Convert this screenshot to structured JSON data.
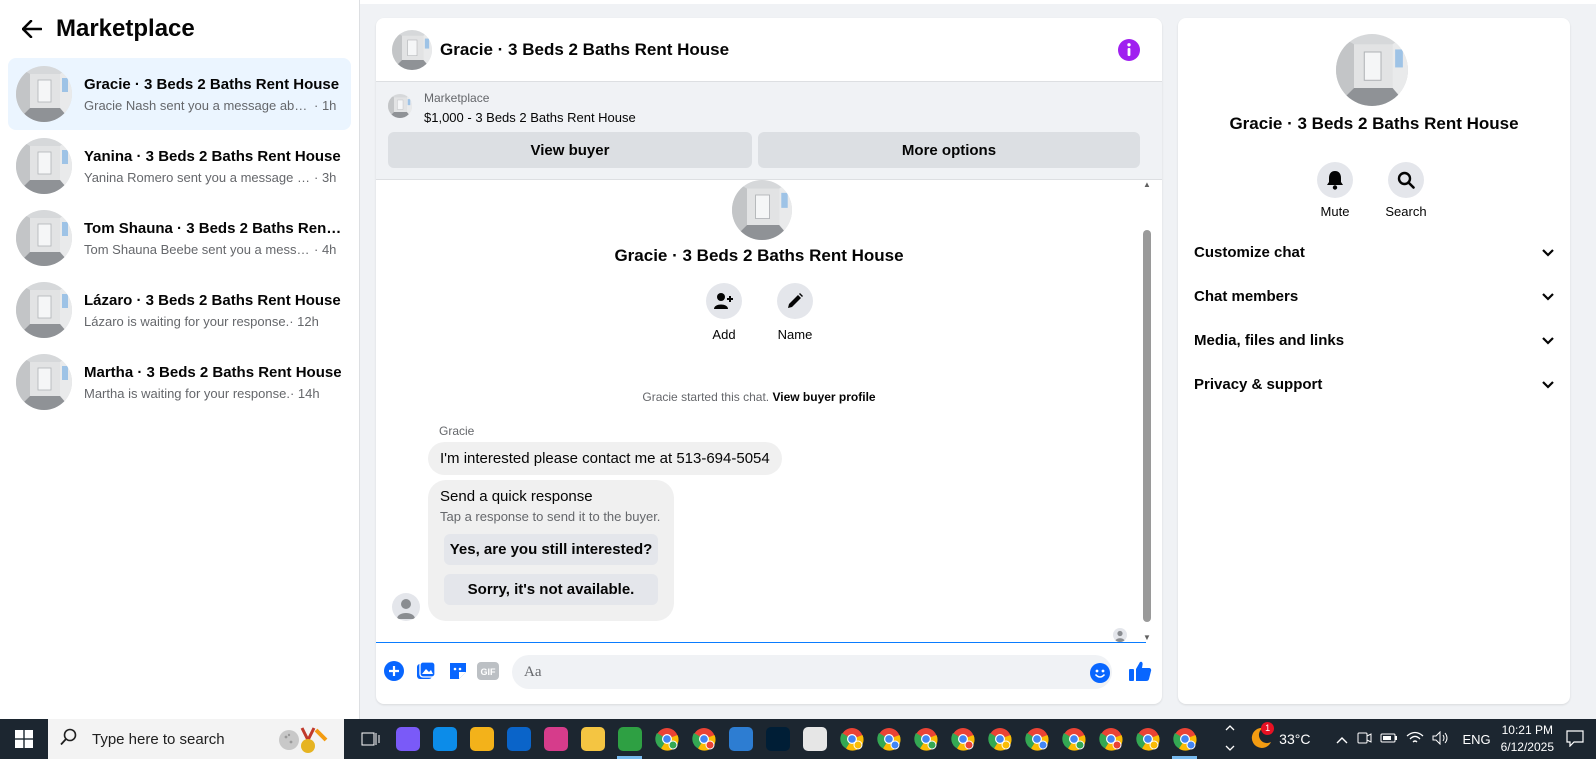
{
  "sidebar": {
    "title": "Marketplace",
    "conversations": [
      {
        "title": "Gracie · 3 Beds 2 Baths Rent House",
        "snippet": "Gracie Nash sent you a message abou...",
        "time": " · 1h",
        "active": true
      },
      {
        "title": "Yanina · 3 Beds 2 Baths Rent House",
        "snippet": "Yanina Romero sent you a message a...",
        "time": " · 3h",
        "active": false
      },
      {
        "title": "Tom Shauna · 3 Beds 2 Baths Rent ...",
        "snippet": "Tom Shauna Beebe sent you a messag...",
        "time": " · 4h",
        "active": false
      },
      {
        "title": "Lázaro · 3 Beds 2 Baths Rent House",
        "snippet": "Lázaro is waiting for your response.",
        "time": " · 12h",
        "active": false
      },
      {
        "title": "Martha · 3 Beds 2 Baths Rent House",
        "snippet": "Martha is waiting for your response.",
        "time": " · 14h",
        "active": false
      }
    ]
  },
  "chat": {
    "title": "Gracie · 3 Beds 2 Baths Rent House",
    "listing": {
      "source": "Marketplace",
      "price_title": "$1,000 - 3 Beds 2 Baths Rent House",
      "view_buyer": "View buyer",
      "more_options": "More options"
    },
    "intro_title": "Gracie · 3 Beds 2 Baths Rent House",
    "actions": {
      "add": "Add",
      "name": "Name"
    },
    "started_text": "Gracie started this chat. ",
    "started_link": "View buyer profile",
    "sender": "Gracie",
    "message": "I'm interested please contact me at 513-694-5054",
    "quick_response": {
      "title": "Send a quick response",
      "subtitle": "Tap a response to send it to the buyer.",
      "options": [
        "Yes, are you still interested?",
        "Sorry, it's not available."
      ]
    },
    "composer": {
      "placeholder": "Aa"
    }
  },
  "info_panel": {
    "title": "Gracie · 3 Beds 2 Baths Rent House",
    "mute": "Mute",
    "search": "Search",
    "sections": [
      "Customize chat",
      "Chat members",
      "Media, files and links",
      "Privacy & support"
    ]
  },
  "taskbar": {
    "search_placeholder": "Type here to search",
    "temperature": "33°C",
    "language": "ENG",
    "time": "10:21 PM",
    "date": "6/12/2025",
    "weather_badge": "1"
  },
  "colors": {
    "accent": "#0866ff",
    "info_icon": "#a020f0",
    "active_row": "#ebf5ff"
  }
}
